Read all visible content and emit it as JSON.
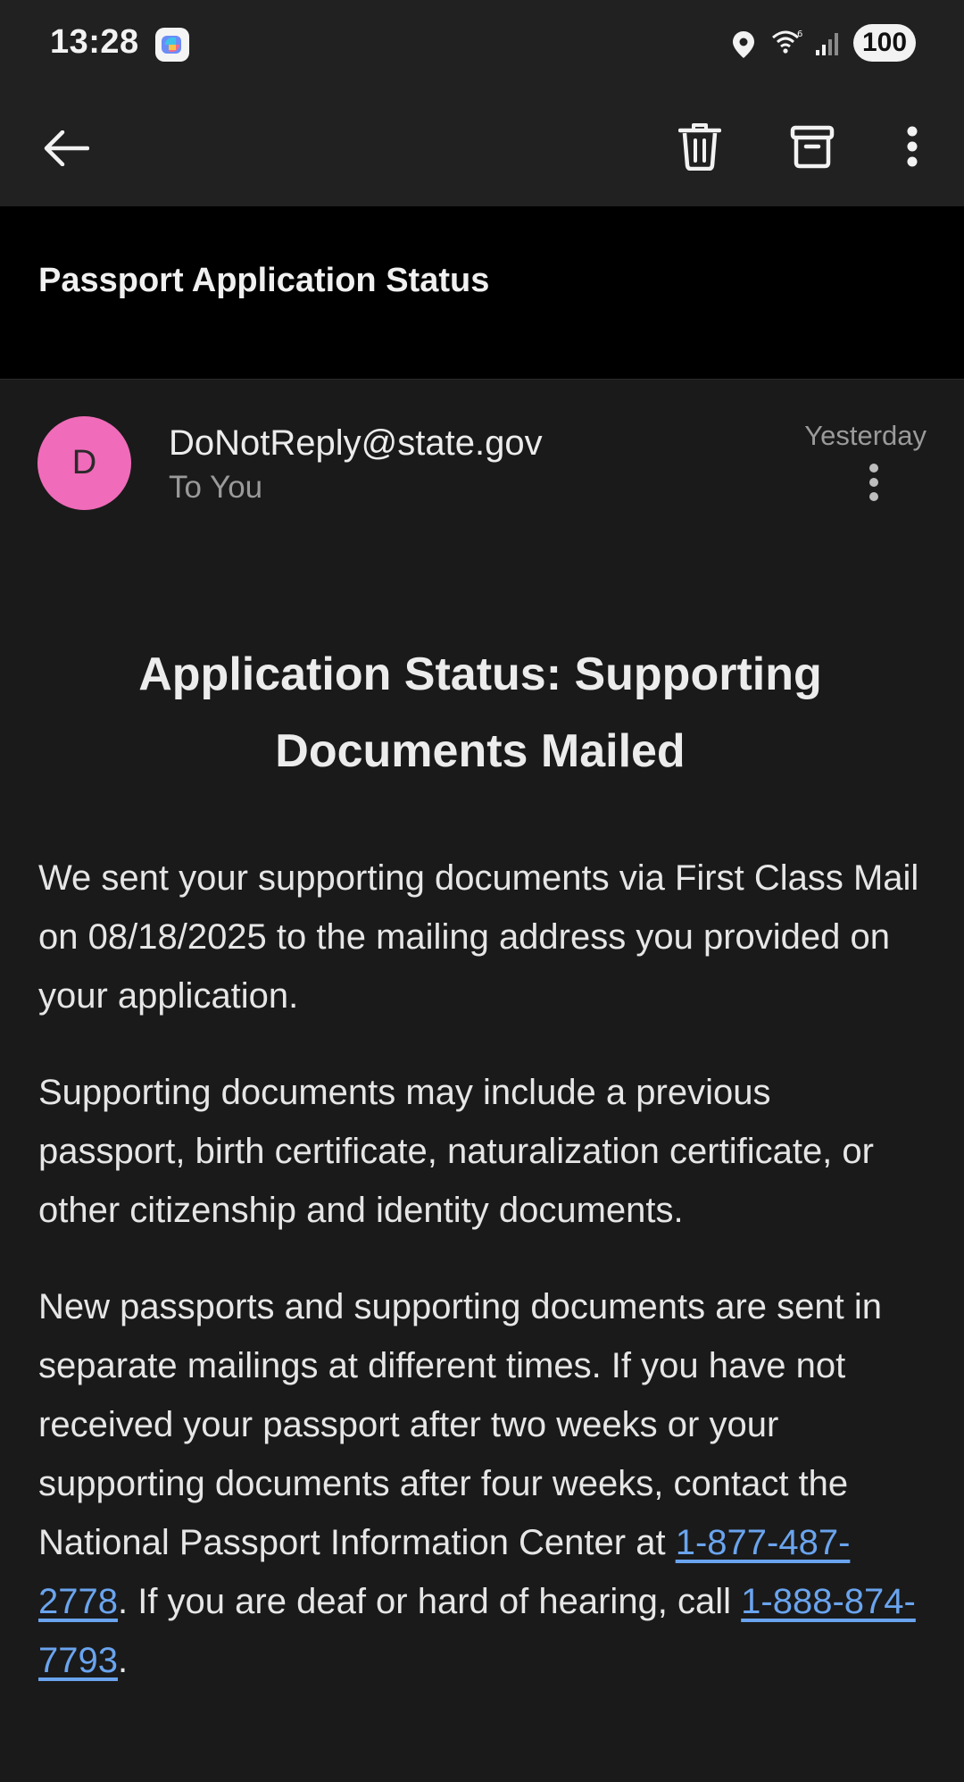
{
  "status_bar": {
    "time": "13:28",
    "battery": "100",
    "icons": [
      "copilot-app-icon",
      "location-icon",
      "wifi-icon",
      "signal-icon"
    ]
  },
  "toolbar": {
    "icons": [
      "back-arrow-icon",
      "trash-icon",
      "archive-icon",
      "more-vert-icon"
    ]
  },
  "email": {
    "subject": "Passport Application Status",
    "sender": {
      "initial": "D",
      "email": "DoNotReply@state.gov",
      "to": "To You",
      "date": "Yesterday",
      "avatar_color": "#f06bb9"
    },
    "heading": "Application Status: Supporting Documents Mailed",
    "para1": "We sent your supporting documents via First Class Mail on 08/18/2025 to the mailing address you provided on your application.",
    "para2": "Supporting documents may include a previous passport, birth certificate, naturalization certificate, or other citizenship and identity documents.",
    "para3_part1": "New passports and supporting documents are sent in separate mailings at different times. If you have not received your passport after two weeks or your supporting documents after four weeks, contact the National Passport Information Center at ",
    "phone1": "1-877-487-2778",
    "para3_part2": ". If you are deaf or hard of hearing, call ",
    "phone2": "1-888-874-7793",
    "para3_part3": "."
  },
  "colors": {
    "background": "#1a1a1a",
    "bar": "#212121",
    "subject_band": "#000000",
    "link": "#6aa4ee"
  }
}
